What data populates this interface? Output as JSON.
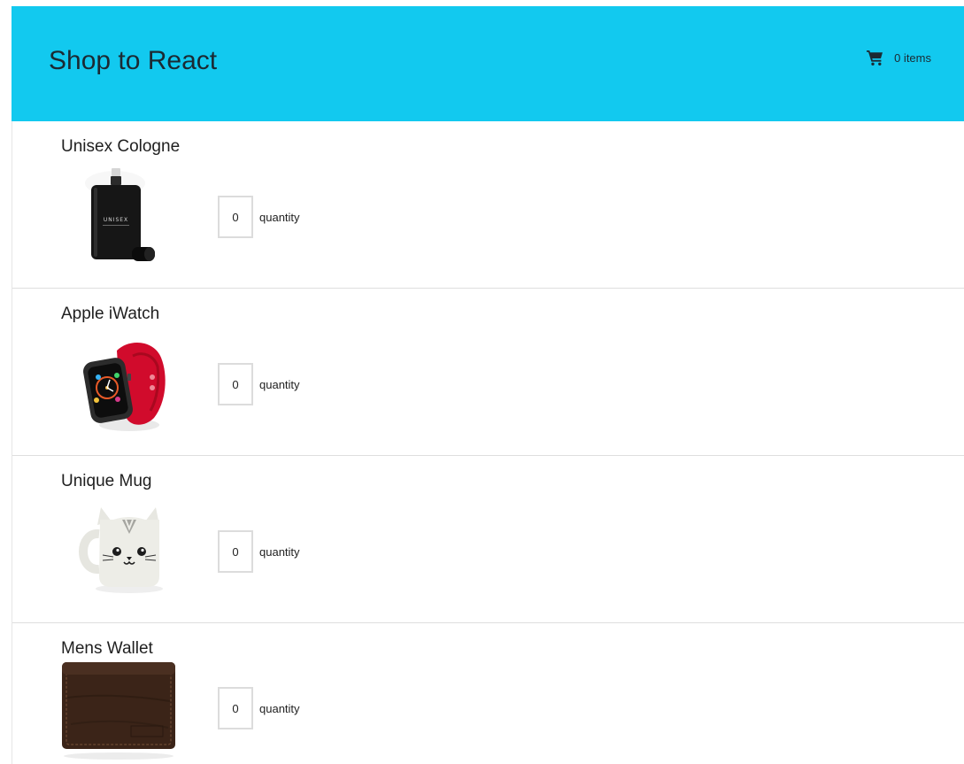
{
  "header": {
    "title": "Shop to React",
    "cart_count_label": "0 items",
    "brand_color": "#12c9ef",
    "cart_icon": "shopping-cart-icon"
  },
  "products": [
    {
      "name": "Unisex Cologne",
      "image": "cologne-bottle-image",
      "image_text": "UNISEX",
      "quantity": "0",
      "quantity_label": "quantity"
    },
    {
      "name": "Apple iWatch",
      "image": "apple-watch-image",
      "quantity": "0",
      "quantity_label": "quantity"
    },
    {
      "name": "Unique Mug",
      "image": "cat-mug-image",
      "quantity": "0",
      "quantity_label": "quantity"
    },
    {
      "name": "Mens Wallet",
      "image": "leather-wallet-image",
      "quantity": "0",
      "quantity_label": "quantity"
    }
  ]
}
